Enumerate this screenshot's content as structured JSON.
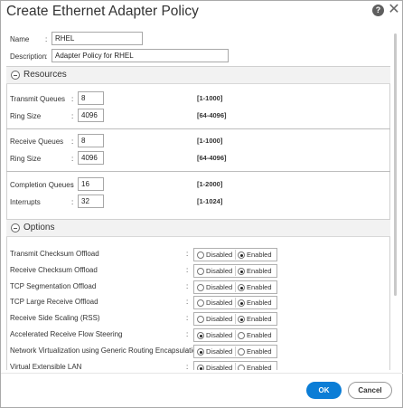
{
  "dialog": {
    "title": "Create Ethernet Adapter Policy",
    "help_label": "?",
    "close_label": "✕"
  },
  "general": {
    "name_label": "Name",
    "name_value": "RHEL",
    "description_label": "Description",
    "description_value": "Adapter Policy for RHEL"
  },
  "resources": {
    "title": "Resources",
    "fields": [
      {
        "label": "Transmit Queues",
        "value": "8",
        "range": "[1-1000]"
      },
      {
        "label": "Ring Size",
        "value": "4096",
        "range": "[64-4096]"
      },
      {
        "label": "Receive Queues",
        "value": "8",
        "range": "[1-1000]"
      },
      {
        "label": "Ring Size",
        "value": "4096",
        "range": "[64-4096]"
      },
      {
        "label": "Completion Queues",
        "value": "16",
        "range": "[1-2000]"
      },
      {
        "label": "Interrupts",
        "value": "32",
        "range": "[1-1024]"
      }
    ]
  },
  "options": {
    "title": "Options",
    "disabled_label": "Disabled",
    "enabled_label": "Enabled",
    "items": [
      {
        "label": "Transmit Checksum Offload",
        "selected": "Enabled"
      },
      {
        "label": "Receive Checksum Offload",
        "selected": "Enabled"
      },
      {
        "label": "TCP Segmentation Offload",
        "selected": "Enabled"
      },
      {
        "label": "TCP Large Receive Offload",
        "selected": "Enabled"
      },
      {
        "label": "Receive Side Scaling (RSS)",
        "selected": "Enabled"
      },
      {
        "label": "Accelerated Receive Flow Steering",
        "selected": "Disabled"
      },
      {
        "label": "Network Virtualization using Generic Routing Encapsulation",
        "selected": "Disabled"
      },
      {
        "label": "Virtual Extensible LAN",
        "selected": "Disabled"
      }
    ]
  },
  "colon": ":",
  "footer": {
    "ok_label": "OK",
    "cancel_label": "Cancel"
  },
  "colors": {
    "primary_button": "#0b7dd6",
    "section_header_bg": "#f2f2f2"
  }
}
